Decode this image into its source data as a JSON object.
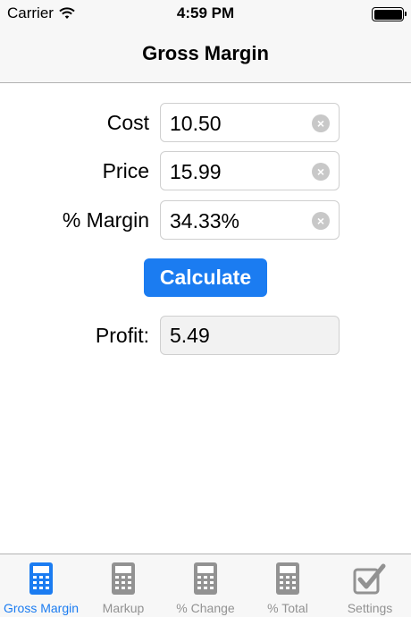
{
  "status_bar": {
    "carrier": "Carrier",
    "time": "4:59 PM"
  },
  "nav": {
    "title": "Gross Margin"
  },
  "form": {
    "cost": {
      "label": "Cost",
      "value": "10.50"
    },
    "price": {
      "label": "Price",
      "value": "15.99"
    },
    "margin": {
      "label": "% Margin",
      "value": "34.33%"
    },
    "calculate_label": "Calculate",
    "profit": {
      "label": "Profit:",
      "value": "5.49"
    }
  },
  "tabs": [
    {
      "label": "Gross Margin",
      "icon": "calculator-icon",
      "active": true
    },
    {
      "label": "Markup",
      "icon": "calculator-icon",
      "active": false
    },
    {
      "label": "% Change",
      "icon": "calculator-icon",
      "active": false
    },
    {
      "label": "% Total",
      "icon": "calculator-icon",
      "active": false
    },
    {
      "label": "Settings",
      "icon": "checkmark-icon",
      "active": false
    }
  ],
  "colors": {
    "accent": "#1b7cf1",
    "inactive": "#929292",
    "bar_bg": "#f7f7f7"
  }
}
